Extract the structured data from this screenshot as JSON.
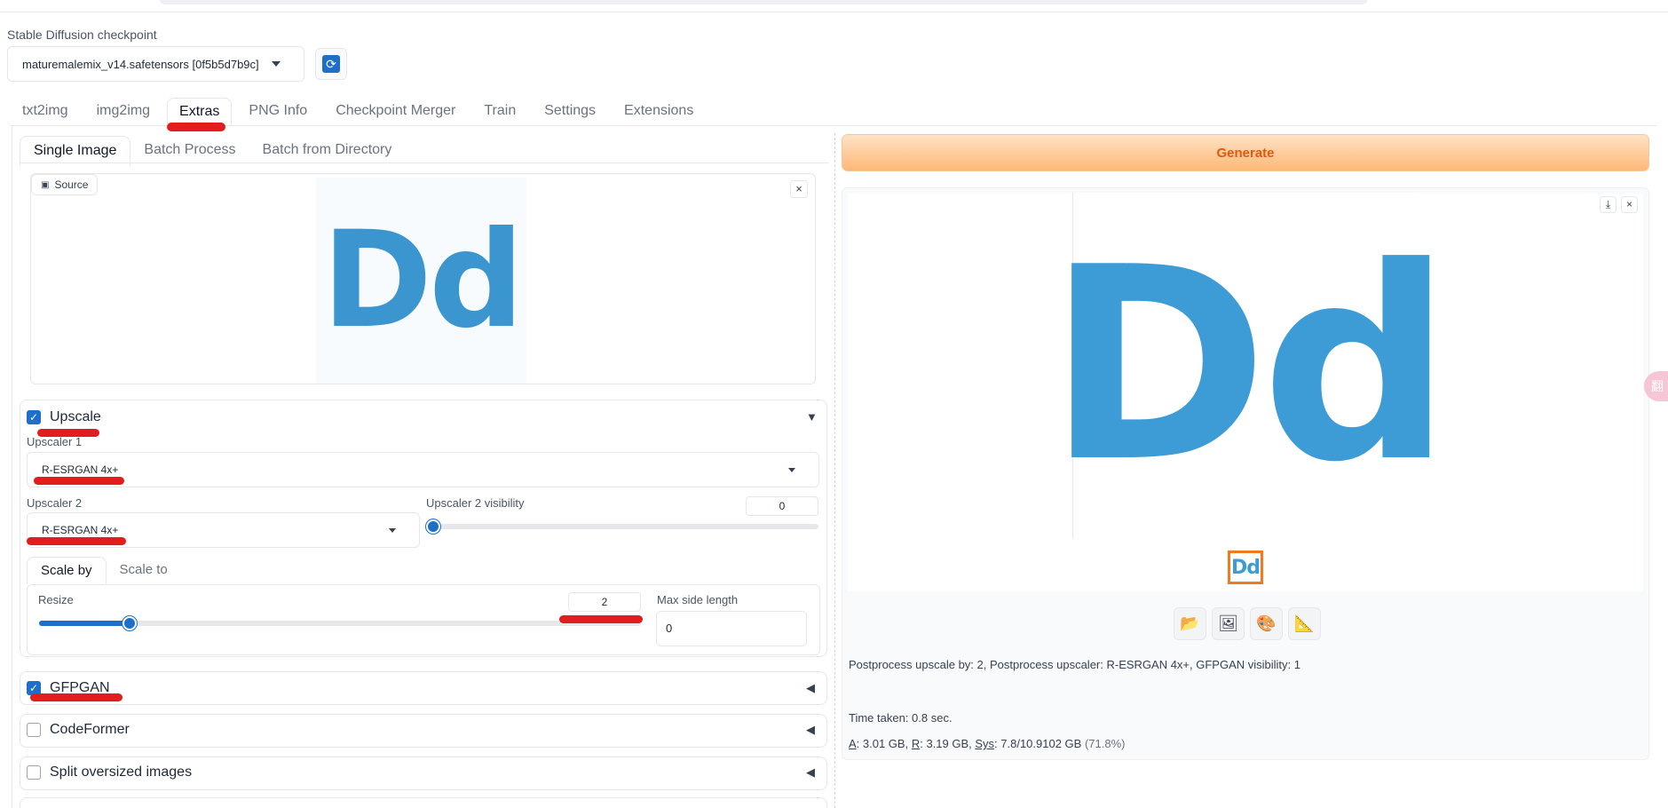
{
  "checkpoint": {
    "label": "Stable Diffusion checkpoint",
    "value": "maturemalemix_v14.safetensors [0f5b5d7b9c]"
  },
  "main_tabs": [
    "txt2img",
    "img2img",
    "Extras",
    "PNG Info",
    "Checkpoint Merger",
    "Train",
    "Settings",
    "Extensions"
  ],
  "sub_tabs": [
    "Single Image",
    "Batch Process",
    "Batch from Directory"
  ],
  "source": {
    "label": "Source",
    "image_text": "Dd"
  },
  "upscale": {
    "title": "Upscale",
    "checked": true,
    "upscaler1_label": "Upscaler 1",
    "upscaler1_value": "R-ESRGAN 4x+",
    "upscaler2_label": "Upscaler 2",
    "upscaler2_value": "R-ESRGAN 4x+",
    "visibility_label": "Upscaler 2 visibility",
    "visibility_value": "0",
    "visibility_fraction": 0,
    "scale_tabs": [
      "Scale by",
      "Scale to"
    ],
    "resize_label": "Resize",
    "resize_value": "2",
    "resize_fraction": 0.15,
    "max_side_label": "Max side length",
    "max_side_value": "0"
  },
  "gfpgan": {
    "title": "GFPGAN",
    "checked": true
  },
  "codeformer": {
    "title": "CodeFormer",
    "checked": false
  },
  "split": {
    "title": "Split oversized images",
    "checked": false
  },
  "generate_label": "Generate",
  "result": {
    "image_text": "Dd",
    "thumb_text": "Dd",
    "info": "Postprocess upscale by: 2, Postprocess upscaler: R-ESRGAN 4x+, GFPGAN visibility: 1",
    "time_taken": "Time taken: 0.8 sec.",
    "mem_a_key": "A",
    "mem_a": ": 3.01 GB, ",
    "mem_r_key": "R",
    "mem_r": ": 3.19 GB, ",
    "mem_sys_key": "Sys",
    "mem_sys": ": 7.8/10.9102 GB ",
    "mem_pct": "(71.8%)"
  },
  "icons": {
    "refresh": "refresh-icon",
    "folder": "folder-icon",
    "image": "image-icon",
    "palette": "palette-icon",
    "ruler": "ruler-icon"
  },
  "colors": {
    "accent": "#1d6fc9",
    "generate_text": "#e05a0c",
    "annotation_red": "#e11d1d"
  },
  "side_pill_text": "翻"
}
